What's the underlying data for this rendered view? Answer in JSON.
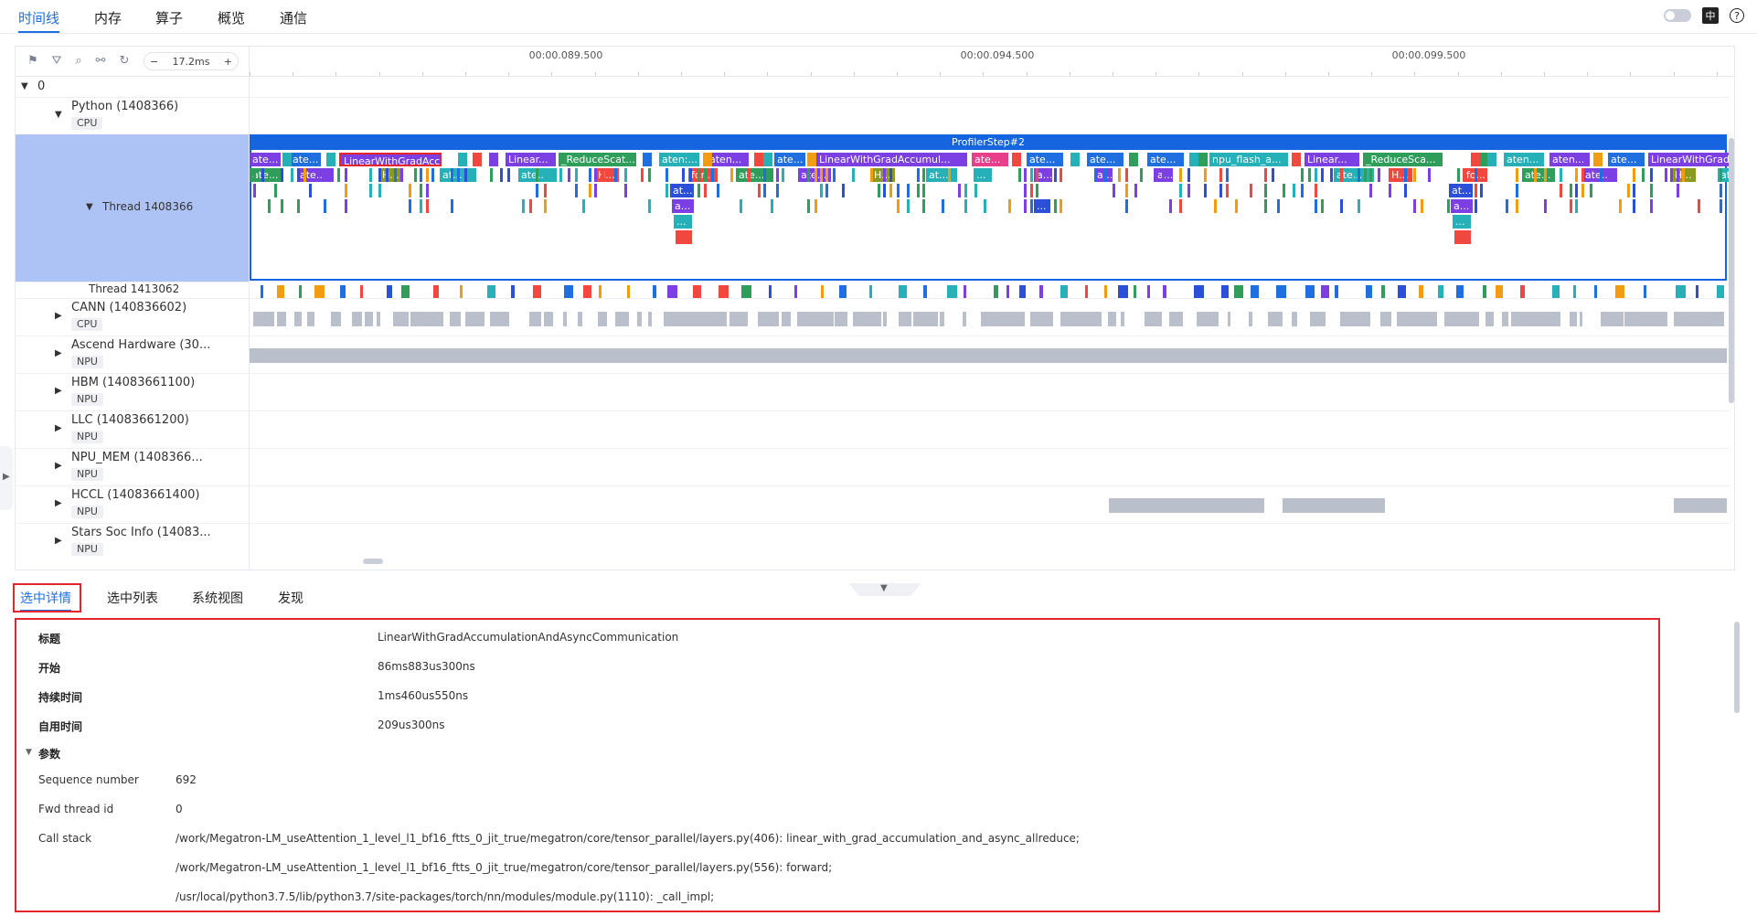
{
  "nav": {
    "tabs": [
      {
        "label": "时间线",
        "active": true
      },
      {
        "label": "内存",
        "active": false
      },
      {
        "label": "算子",
        "active": false
      },
      {
        "label": "概览",
        "active": false
      },
      {
        "label": "通信",
        "active": false
      }
    ],
    "icons": [
      "toggle-switch",
      "language-icon",
      "help-icon"
    ],
    "help_glyph": "?",
    "lang_glyph": "中"
  },
  "toolbar": {
    "icons": [
      "flag-icon",
      "filter-icon",
      "search-icon",
      "link-icon",
      "reset-icon"
    ],
    "zoom_value": "17.2ms",
    "zoom_out": "−",
    "zoom_in": "+"
  },
  "ruler": {
    "ticks": [
      "00:00.089.500",
      "00:00.094.500",
      "00:00.099.500"
    ]
  },
  "lanes": {
    "root": {
      "label": "0"
    },
    "python": {
      "label": "Python (1408366)",
      "badge": "CPU"
    },
    "thread_main": {
      "label": "Thread 1408366"
    },
    "thread_2": {
      "label": "Thread 1413062"
    },
    "cann": {
      "label": "CANN (140836602)",
      "badge": "CPU"
    },
    "ascend": {
      "label": "Ascend Hardware (30...",
      "badge": "NPU"
    },
    "hbm": {
      "label": "HBM (14083661100)",
      "badge": "NPU"
    },
    "llc": {
      "label": "LLC (14083661200)",
      "badge": "NPU"
    },
    "npu_mem": {
      "label": "NPU_MEM (1408366...",
      "badge": "NPU"
    },
    "hccl": {
      "label": "HCCL (14083661400)",
      "badge": "NPU"
    },
    "stars": {
      "label": "Stars Soc Info (14083...",
      "badge": "NPU"
    }
  },
  "trace": {
    "step_label": "ProfilerStep#2",
    "row1": [
      "ate...",
      "ate...",
      "LinearWithGradAccu...",
      "Linear...",
      "_ReduceScat...",
      "aten:...",
      "aten...",
      "ate...",
      "LinearWithGradAccumul...",
      "ate...",
      "ate...",
      "ate...",
      "ate...",
      "npu_flash_a...",
      "Linear...",
      "_ReduceSca...",
      "aten...",
      "aten...",
      "ate...",
      "LinearWithGradAccu..."
    ],
    "row2": [
      "ate...",
      "ate...",
      "H...",
      "at...",
      "ate...",
      "H...",
      "for...",
      "ate...",
      "ate...",
      "H...",
      "at...",
      "...",
      "a...",
      "a...",
      "a...",
      "ate...",
      "H...",
      "fo...",
      "ate...",
      "ate...",
      "H...",
      "at..."
    ],
    "row3": [
      "at...",
      "at..."
    ],
    "row4": [
      "a...",
      "a...",
      "..."
    ],
    "row5": [
      "...",
      "..."
    ],
    "colors": {
      "purple": "#7b3fe4",
      "blue": "#1f6fe0",
      "teal": "#26b0b8",
      "green": "#2f9e5a",
      "olive": "#8a9a1e",
      "red": "#f0483e",
      "orange": "#f39c12",
      "pink": "#e83e8c",
      "darkblue": "#2b4fd9",
      "gray": "#b9c0cc",
      "stepbar": "#1565e0",
      "selectedlane": "#aec3f5"
    }
  },
  "bottom_tabs": [
    {
      "label": "选中详情",
      "active": true
    },
    {
      "label": "选中列表",
      "active": false
    },
    {
      "label": "系统视图",
      "active": false
    },
    {
      "label": "发现",
      "active": false
    }
  ],
  "details": {
    "rows": [
      {
        "label": "标题",
        "value": "LinearWithGradAccumulationAndAsyncCommunication"
      },
      {
        "label": "开始",
        "value": "86ms883us300ns"
      },
      {
        "label": "持续时间",
        "value": "1ms460us550ns"
      },
      {
        "label": "自用时间",
        "value": "209us300ns"
      }
    ],
    "params_title": "参数",
    "params": [
      {
        "label": "Sequence number",
        "value": "692"
      },
      {
        "label": "Fwd thread id",
        "value": "0"
      },
      {
        "label": "Call stack",
        "value": "/work/Megatron-LM_useAttention_1_level_l1_bf16_ftts_0_jit_true/megatron/core/tensor_parallel/layers.py(406): linear_with_grad_accumulation_and_async_allreduce;"
      },
      {
        "label": "",
        "value": "/work/Megatron-LM_useAttention_1_level_l1_bf16_ftts_0_jit_true/megatron/core/tensor_parallel/layers.py(556): forward;"
      },
      {
        "label": "",
        "value": "/usr/local/python3.7.5/lib/python3.7/site-packages/torch/nn/modules/module.py(1110): _call_impl;"
      }
    ]
  }
}
